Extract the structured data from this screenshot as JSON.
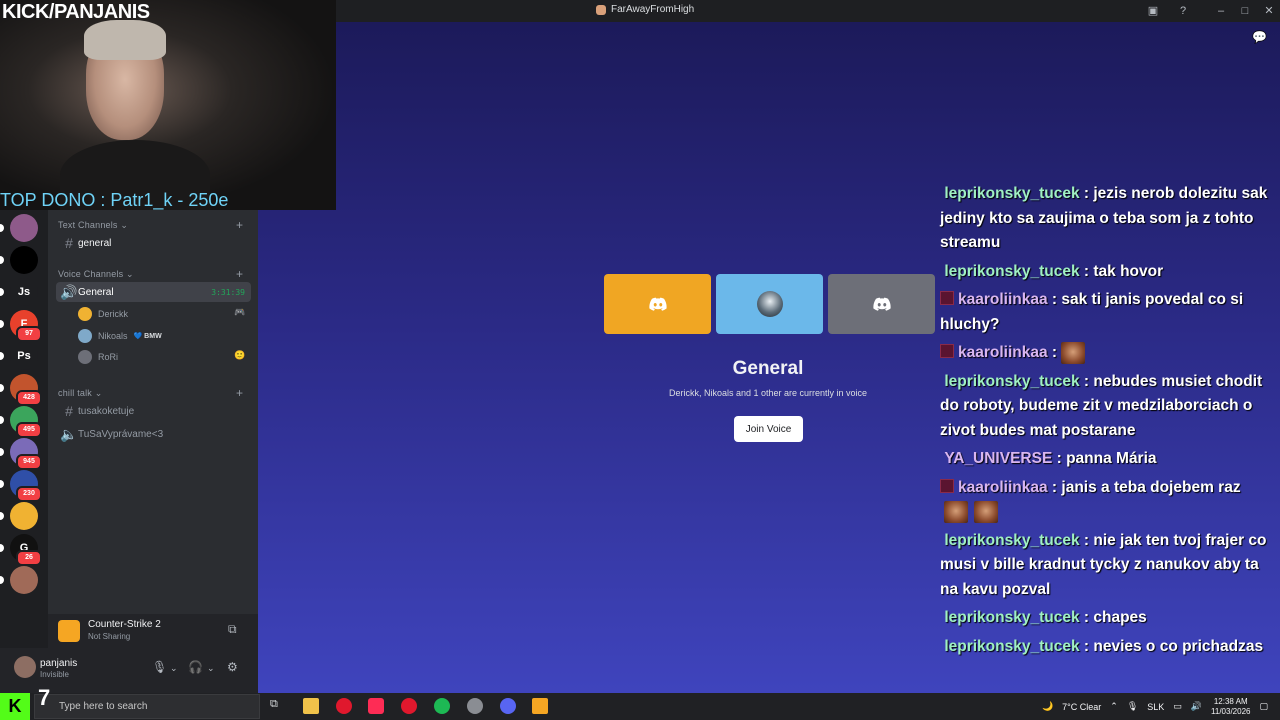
{
  "window": {
    "title": "FarAwayFromHigh"
  },
  "stream_overlay": {
    "kick_handle": "KICK/PANJANIS",
    "top_dono": "TOP DONO : Patr1_k - 250e"
  },
  "server_rail": {
    "items": [
      {
        "label": "",
        "color": "#8e5a8a",
        "badge": ""
      },
      {
        "label": "",
        "color": "#000000",
        "badge": ""
      },
      {
        "label": "Js",
        "color": "#1e1f22",
        "badge": ""
      },
      {
        "label": "F",
        "color": "#e8412c",
        "badge": "97"
      },
      {
        "label": "Ps",
        "color": "#1e1f22",
        "badge": ""
      },
      {
        "label": "",
        "color": "#c2542d",
        "badge": "428"
      },
      {
        "label": "",
        "color": "#3ba55c",
        "badge": "495"
      },
      {
        "label": "",
        "color": "#7b6bb8",
        "badge": "945"
      },
      {
        "label": "",
        "color": "#2f4fa8",
        "badge": "230"
      },
      {
        "label": "",
        "color": "#f0b232",
        "badge": ""
      },
      {
        "label": "G",
        "color": "#111111",
        "badge": "26"
      },
      {
        "label": "",
        "color": "#a06a58",
        "badge": ""
      }
    ]
  },
  "channels": {
    "text_category": "Text Channels",
    "text_items": [
      {
        "name": "general"
      }
    ],
    "voice_category": "Voice Channels",
    "voice_channel": {
      "name": "General",
      "timer": "3:31:39"
    },
    "voice_users": [
      {
        "name": "Derickk",
        "avatar_color": "#f0b232",
        "tag": ""
      },
      {
        "name": "Nikoals",
        "avatar_color": "#7fa9c9",
        "tag": "💙 BMW"
      },
      {
        "name": "RoRi",
        "avatar_color": "#6d6f78",
        "tag": ""
      }
    ],
    "chill_category": "chill talk",
    "chill_items": [
      {
        "name": "tusakoketuje"
      },
      {
        "name": "TuSaVyprávame<3"
      }
    ]
  },
  "activity": {
    "game": "Counter-Strike 2",
    "status": "Not Sharing"
  },
  "user": {
    "name": "panjanis",
    "status": "Invisible"
  },
  "voice_view": {
    "channel_name": "General",
    "subtitle": "Derickk, Nikoals and 1 other are currently in voice",
    "join_label": "Join Voice",
    "tiles": [
      {
        "color": "#f0a623"
      },
      {
        "color": "#6bb8ea"
      },
      {
        "color": "#6d6f78"
      }
    ]
  },
  "chat": {
    "messages": [
      {
        "user": "leprikonsky_tucek",
        "user_color": "#9ff0c3",
        "text": "jezis nerob dolezitu sak jediny kto sa zaujima o teba som ja z tohto streamu",
        "badge": false,
        "emotes": 0
      },
      {
        "user": "leprikonsky_tucek",
        "user_color": "#9ff0c3",
        "text": "tak hovor",
        "badge": false,
        "emotes": 0
      },
      {
        "user": "kaaroliinkaa",
        "user_color": "#d9b6f0",
        "text": "sak ti janis povedal co si hluchy?",
        "badge": true,
        "emotes": 0
      },
      {
        "user": "kaaroliinkaa",
        "user_color": "#d9b6f0",
        "text": "",
        "badge": true,
        "emotes": 1
      },
      {
        "user": "leprikonsky_tucek",
        "user_color": "#9ff0c3",
        "text": "nebudes musiet chodit do roboty, budeme zit v medzilaborciach o zivot budes mat postarane",
        "badge": false,
        "emotes": 0
      },
      {
        "user": "YA_UNIVERSE",
        "user_color": "#d9b6f0",
        "text": "panna Mária",
        "badge": false,
        "emotes": 0
      },
      {
        "user": "kaaroliinkaa",
        "user_color": "#d9b6f0",
        "text": "janis a teba dojebem raz",
        "badge": true,
        "emotes": 2
      },
      {
        "user": "leprikonsky_tucek",
        "user_color": "#9ff0c3",
        "text": "nie jak ten tvoj frajer co musi v bille kradnut tycky z nanukov aby ta na kavu pozval",
        "badge": false,
        "emotes": 0
      },
      {
        "user": "leprikonsky_tucek",
        "user_color": "#9ff0c3",
        "text": "chapes",
        "badge": false,
        "emotes": 0
      },
      {
        "user": "leprikonsky_tucek",
        "user_color": "#9ff0c3",
        "text": "nevies o co prichadzas",
        "badge": false,
        "emotes": 0
      }
    ]
  },
  "taskbar": {
    "search_placeholder": "Type here to search",
    "kick_number": "7",
    "weather": "7°C  Clear",
    "language": "SLK",
    "time": "12:38 AM",
    "date": "11/03/2026"
  }
}
